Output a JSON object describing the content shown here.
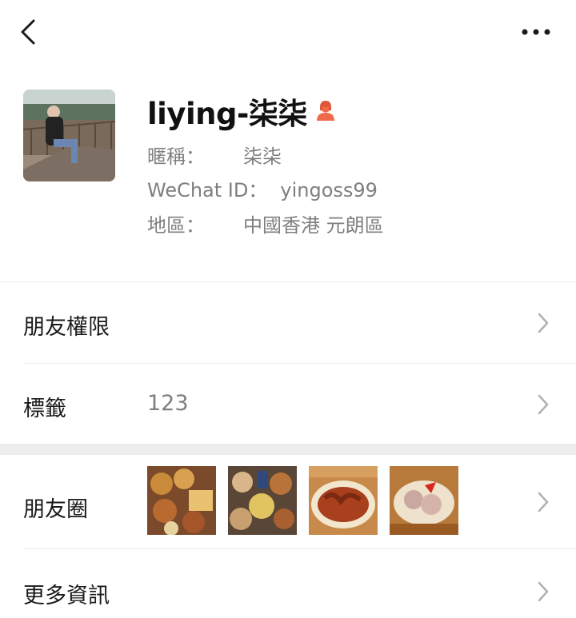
{
  "profile": {
    "name": "liying-柒柒",
    "nickname_label": "暱稱：",
    "nickname_value": "柒柒",
    "wechat_id_label": "WeChat ID：",
    "wechat_id_value": "yingoss99",
    "region_label": "地區：",
    "region_value": "中國香港  元朗區",
    "gender_icon": "female-user-icon",
    "gender_color": "#f06a4a"
  },
  "rows": {
    "permissions_label": "朋友權限",
    "tags_label": "標籤",
    "tags_value": "123",
    "moments_label": "朋友圈",
    "more_info_label": "更多資訊"
  },
  "icons": {
    "back": "chevron-left-icon",
    "more": "ellipsis-icon",
    "row_arrow": "chevron-right-icon"
  },
  "colors": {
    "divider": "#ececec",
    "secondary_text": "#7f7f7f",
    "section_gap": "#ededed"
  }
}
